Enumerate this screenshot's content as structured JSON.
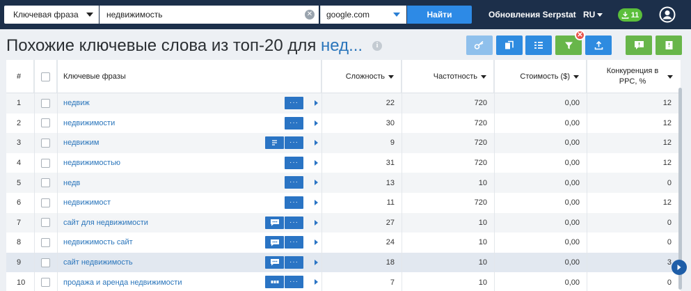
{
  "topbar": {
    "search_type": "Ключевая фраза",
    "search_value": "недвижимость",
    "database": "google.com",
    "find_label": "Найти",
    "updates_label": "Обновления Serpstat",
    "language": "RU",
    "downloads_count": "11"
  },
  "page": {
    "title_prefix": "Похожие ключевые слова из топ-20 для ",
    "title_keyword": "нед..."
  },
  "table": {
    "headers": {
      "num": "#",
      "keyword": "Ключевые фразы",
      "difficulty": "Сложность",
      "volume": "Частотность",
      "cost": "Стоимость ($)",
      "competition": "Конкуренция в PPC, %"
    },
    "rows": [
      {
        "num": "1",
        "keyword": "недвиж",
        "difficulty": "22",
        "volume": "720",
        "cost": "0,00",
        "competition": "12",
        "extra_icon": ""
      },
      {
        "num": "2",
        "keyword": "недвижимости",
        "difficulty": "30",
        "volume": "720",
        "cost": "0,00",
        "competition": "12",
        "extra_icon": ""
      },
      {
        "num": "3",
        "keyword": "недвижим",
        "difficulty": "9",
        "volume": "720",
        "cost": "0,00",
        "competition": "12",
        "extra_icon": "list-icon"
      },
      {
        "num": "4",
        "keyword": "недвижимостью",
        "difficulty": "31",
        "volume": "720",
        "cost": "0,00",
        "competition": "12",
        "extra_icon": ""
      },
      {
        "num": "5",
        "keyword": "недв",
        "difficulty": "13",
        "volume": "10",
        "cost": "0,00",
        "competition": "0",
        "extra_icon": ""
      },
      {
        "num": "6",
        "keyword": "недвижимост",
        "difficulty": "11",
        "volume": "720",
        "cost": "0,00",
        "competition": "12",
        "extra_icon": ""
      },
      {
        "num": "7",
        "keyword": "сайт для недвижимости",
        "difficulty": "27",
        "volume": "10",
        "cost": "0,00",
        "competition": "0",
        "extra_icon": "chat-icon"
      },
      {
        "num": "8",
        "keyword": "недвижимость сайт",
        "difficulty": "24",
        "volume": "10",
        "cost": "0,00",
        "competition": "0",
        "extra_icon": "chat-icon"
      },
      {
        "num": "9",
        "keyword": "сайт недвижимость",
        "difficulty": "18",
        "volume": "10",
        "cost": "0,00",
        "competition": "3",
        "extra_icon": "chat-icon"
      },
      {
        "num": "10",
        "keyword": "продажа и аренда недвижимости",
        "difficulty": "7",
        "volume": "10",
        "cost": "0,00",
        "competition": "0",
        "extra_icon": "grid-icon"
      }
    ],
    "highlighted_row": "9"
  },
  "colors": {
    "topbar": "#1c2f4a",
    "accent_blue": "#2d8ae6",
    "link_blue": "#2a75bb",
    "green": "#68b64a",
    "red_badge": "#e8534b"
  }
}
